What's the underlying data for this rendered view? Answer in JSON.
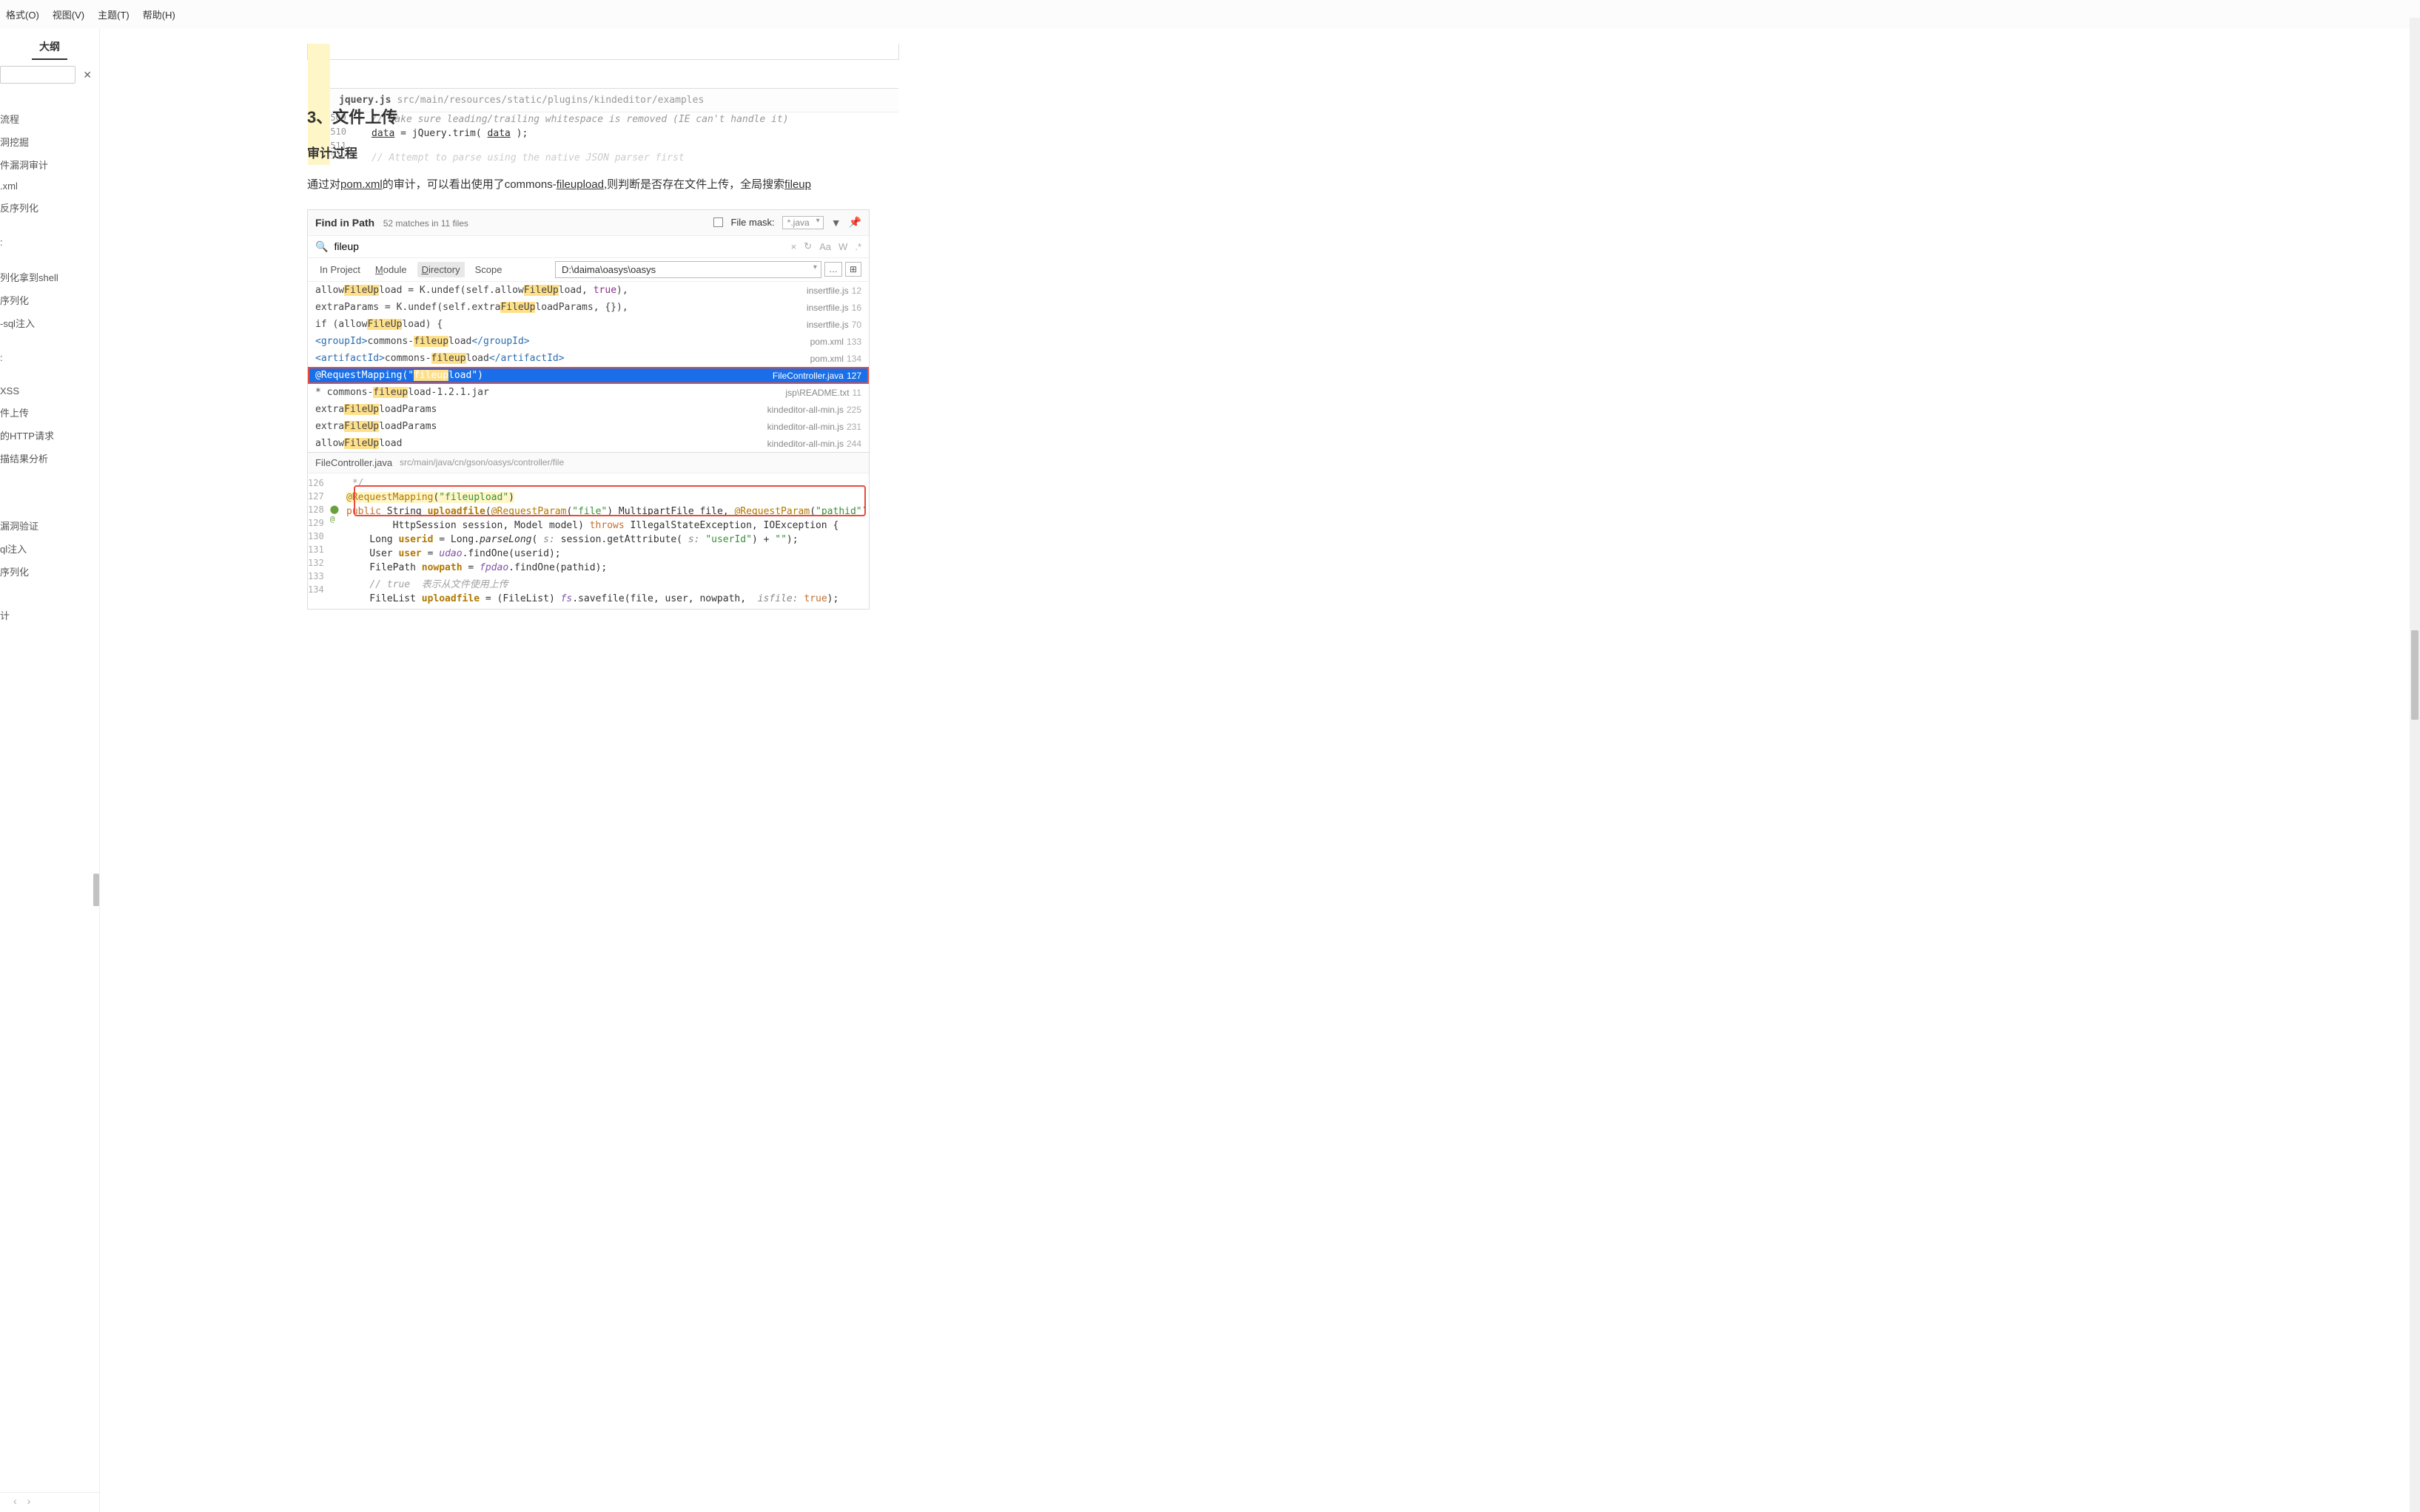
{
  "menubar": {
    "items": [
      "格式(O)",
      "视图(V)",
      "主题(T)",
      "帮助(H)"
    ]
  },
  "outline": {
    "tab_label": "大纲",
    "search_placeholder": "",
    "items_block1": [
      "流程",
      "洞挖掘",
      "件漏洞审计",
      ".xml",
      "反序列化",
      "",
      ":",
      "",
      "列化拿到shell",
      "序列化",
      "-sql注入",
      "",
      ":",
      "",
      "XSS",
      "件上传",
      "的HTTP请求",
      "描结果分析"
    ],
    "items_block2": [
      "漏洞验证",
      "ql注入",
      "序列化",
      "",
      "计"
    ]
  },
  "top_editor": {
    "filename": "jquery.js",
    "filepath": "src/main/resources/static/plugins/kindeditor/examples",
    "lines": [
      {
        "num": "",
        "text": ""
      },
      {
        "num": "509",
        "text": "// Make sure leading/trailing whitespace is removed (IE can't handle it)"
      },
      {
        "num": "510",
        "text_html": "<span class='kw-under'>data</span> = jQuery.trim( <span class='kw-under'>data</span> );"
      },
      {
        "num": "511",
        "text": ""
      },
      {
        "num": "512",
        "text": "// Attempt to parse using the native JSON parser first"
      }
    ]
  },
  "section": {
    "heading": "3、文件上传",
    "subheading": "审计过程",
    "body_prefix": "通过对",
    "body_link1": "pom.xml",
    "body_mid1": "的审计，可以看出使用了commons-",
    "body_link2": "fileupload",
    "body_mid2": ",则判断是否存在文件上传，全局搜索",
    "body_link3": "fileup"
  },
  "find": {
    "title": "Find in Path",
    "count": "52 matches in 11 files",
    "filemask_label": "File mask:",
    "filemask_value": "*.java",
    "query": "fileup",
    "scope_tabs": [
      "In Project",
      "Module",
      "Directory",
      "Scope"
    ],
    "path_value": "D:\\daima\\oasys\\oasys",
    "results": [
      {
        "code": "allowFileUpload = K.undef(self.allowFileUpload, true),",
        "file": "insertfile.js",
        "ln": "12",
        "hl": "FileUp"
      },
      {
        "code": "extraParams = K.undef(self.extraFileUploadParams, {}),",
        "file": "insertfile.js",
        "ln": "16",
        "hl": "FileUp"
      },
      {
        "code": "if (allowFileUpload) {",
        "file": "insertfile.js",
        "ln": "70",
        "hl": "FileUp"
      },
      {
        "code": "<groupId>commons-fileupload</groupId>",
        "file": "pom.xml",
        "ln": "133",
        "hl": "fileup",
        "xml": true
      },
      {
        "code": "<artifactId>commons-fileupload</artifactId>",
        "file": "pom.xml",
        "ln": "134",
        "hl": "fileup",
        "xml": true
      },
      {
        "code": "@RequestMapping(\"fileupload\")",
        "file": "FileController.java",
        "ln": "127",
        "hl": "fileup",
        "selected": true
      },
      {
        "code": "* commons-fileupload-1.2.1.jar",
        "file": "jsp\\README.txt",
        "ln": "11",
        "hl": "fileup"
      },
      {
        "code": "extraFileUploadParams",
        "file": "kindeditor-all-min.js",
        "ln": "225",
        "hl": "FileUp"
      },
      {
        "code": "extraFileUploadParams",
        "file": "kindeditor-all-min.js",
        "ln": "231",
        "hl": "FileUp"
      },
      {
        "code": "allowFileUpload",
        "file": "kindeditor-all-min.js",
        "ln": "244",
        "hl": "FileUp"
      }
    ],
    "preview": {
      "filename": "FileController.java",
      "filepath": "src/main/java/cn/gson/oasys/controller/file",
      "gutter": [
        "126",
        "127",
        "128",
        "129",
        "130",
        "131",
        "132",
        "133",
        "134"
      ],
      "lines": [
        " */",
        "@RequestMapping(\"fileupload\")",
        "public String uploadfile(@RequestParam(\"file\") MultipartFile file, @RequestParam(\"pathid\")",
        "        HttpSession session, Model model) throws IllegalStateException, IOException {",
        "    Long userid = Long.parseLong( s: session.getAttribute( s: \"userId\") + \"\");",
        "    User user = udao.findOne(userid);",
        "    FilePath nowpath = fpdao.findOne(pathid);",
        "    // true  表示从文件使用上传",
        "    FileList uploadfile = (FileList) fs.savefile(file, user, nowpath,  isfile: true);"
      ]
    }
  }
}
